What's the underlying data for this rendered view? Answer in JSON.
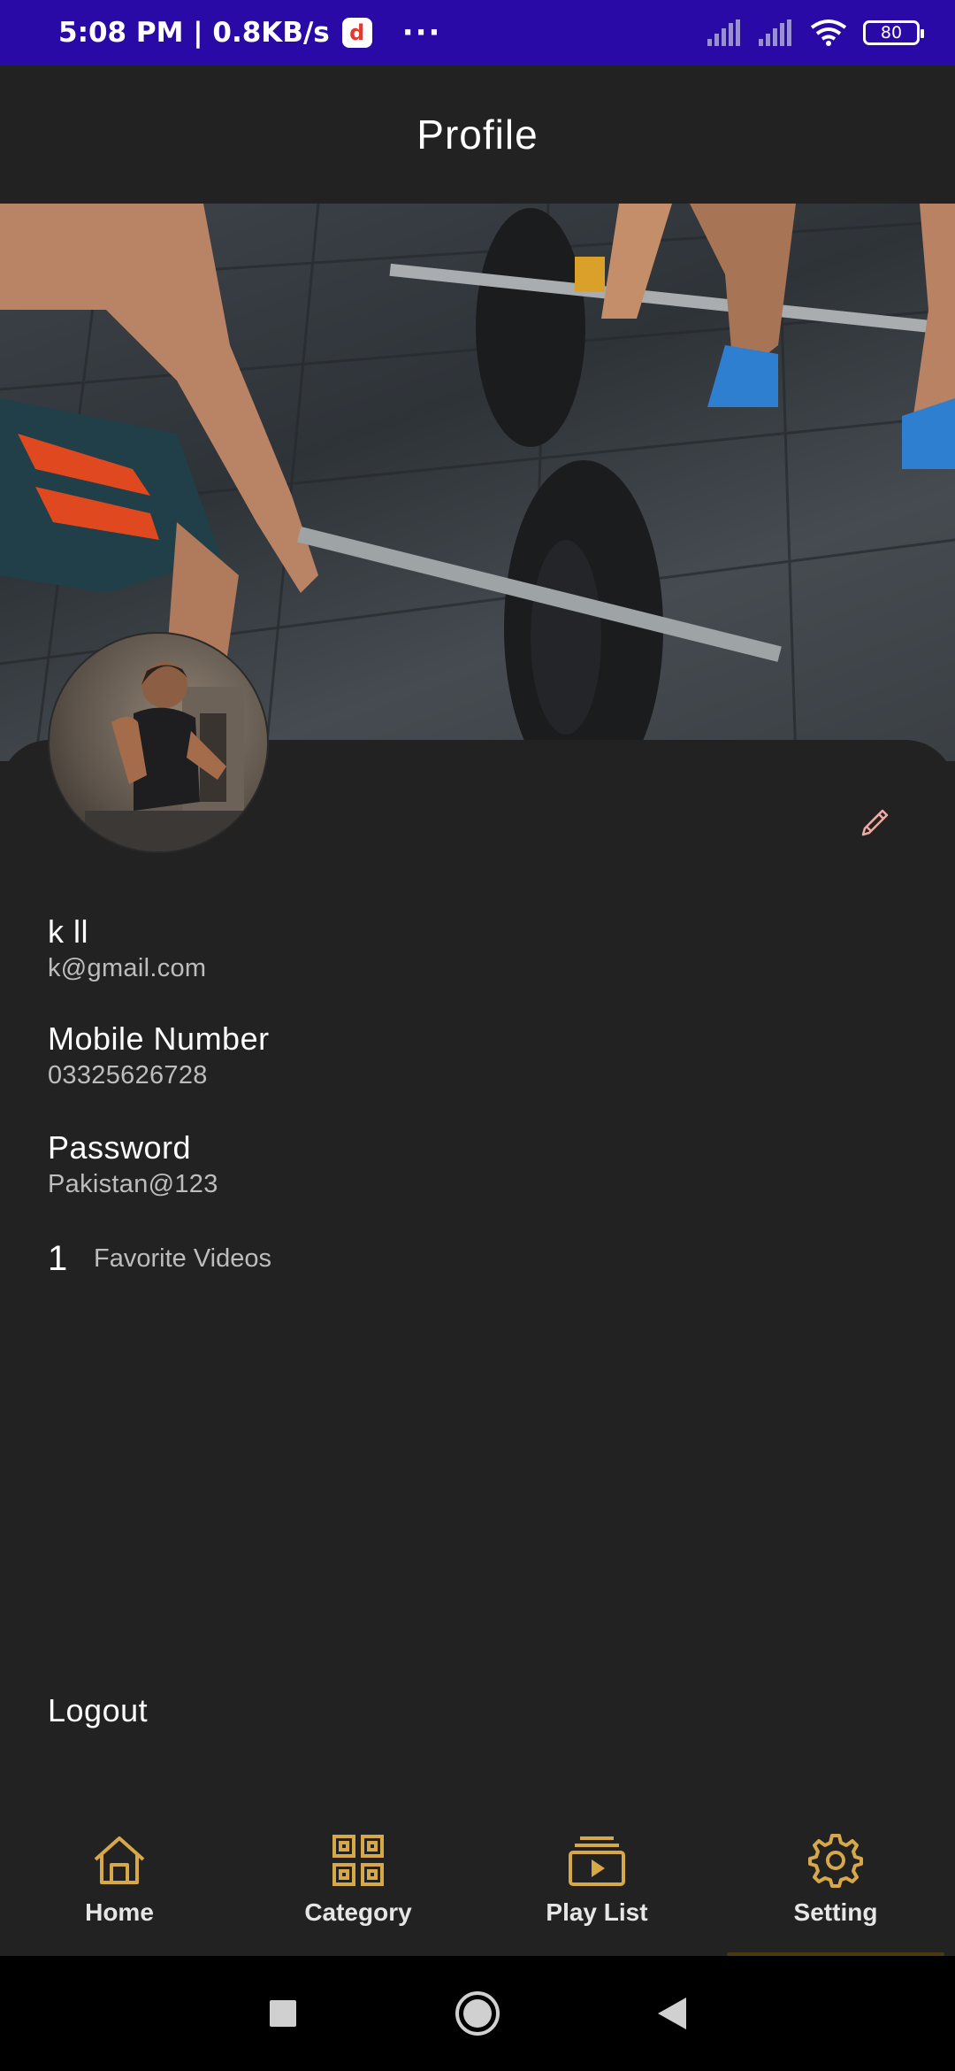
{
  "status_bar": {
    "time_speed": "5:08 PM | 0.8KB/s",
    "app_icon_letter": "d",
    "more": "···",
    "battery": "80"
  },
  "app_bar": {
    "title": "Profile"
  },
  "profile": {
    "name": "k ll",
    "email": "k@gmail.com",
    "mobile_label": "Mobile Number",
    "mobile_value": "03325626728",
    "password_label": "Password",
    "password_value": "Pakistan@123",
    "favorites_count": "1",
    "favorites_label": "Favorite Videos",
    "logout_label": "Logout"
  },
  "bottom_nav": {
    "items": [
      {
        "label": "Home",
        "icon": "home-icon"
      },
      {
        "label": "Category",
        "icon": "grid-icon"
      },
      {
        "label": "Play List",
        "icon": "playlist-icon"
      },
      {
        "label": "Setting",
        "icon": "gear-icon"
      }
    ],
    "active_index": 3
  },
  "colors": {
    "accent": "#d6a84a",
    "status_bar": "#2a0aa6",
    "background": "#222222",
    "edit_icon": "#f0a9a4"
  }
}
